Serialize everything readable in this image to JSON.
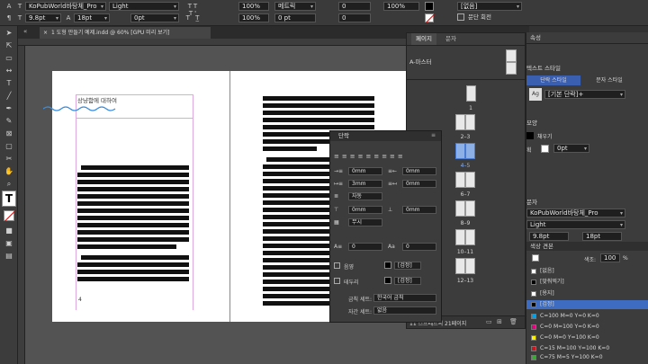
{
  "control_bar": {
    "font_family": "KoPubWorld바탕체_Pro",
    "font_style": "Light",
    "font_size": "9.8pt",
    "leading": "18pt",
    "kerning": "0",
    "tracking": "0pt",
    "scale_h": "100%",
    "scale_v": "100%",
    "baseline_kern": "메트릭",
    "pt_field": "0 pt",
    "zero_field": "0",
    "zero_field2": "0",
    "pct1": "100%",
    "lang": "[없음]",
    "swatch_label": "[없음]",
    "rotate_label": "문단 회전",
    "row2_pt": "0 pt",
    "row2_zero": "0"
  },
  "doc_tab": "1 도형 만들기 예제.indd @ 60% [GPU 미리 보기]",
  "document": {
    "left_heading": "상냥함에 대하여",
    "page_number_left": "4"
  },
  "pages_panel": {
    "tabs": [
      "페이지",
      "문자"
    ],
    "master_label": "A-마스터",
    "spreads": [
      {
        "label": "1"
      },
      {
        "label": "2–3"
      },
      {
        "label": "4–5"
      },
      {
        "label": "6–7"
      },
      {
        "label": "8–9"
      },
      {
        "label": "10–11"
      },
      {
        "label": "12–13"
      }
    ],
    "thumb_letter": "A",
    "footer": "11 스프레드의 21페이지"
  },
  "paragraph_panel": {
    "title": "단락",
    "indent_left": "0mm",
    "indent_right": "0mm",
    "first_indent": "3mm",
    "last_indent": "0mm",
    "auto_label": "자동",
    "space_before": "0mm",
    "space_after": "0mm",
    "none_label": "무시",
    "drop_lines": "0",
    "drop_chars": "0",
    "shading_label": "음영",
    "border_label": "테두리",
    "shading_swatch": "[검정]",
    "border_swatch": "[검정]",
    "kinsoku_label": "금칙 세트:",
    "kinsoku_value": "한국어 금칙",
    "mojikumi_label": "자간 세트:",
    "mojikumi_value": "없음"
  },
  "right_panel": {
    "tab": "속성",
    "char_style_header": "텍스트 스타일",
    "para_style_tab": "단락 스타일",
    "char_style_tab": "문자 스타일",
    "para_style_value": "[기본 단락]+",
    "section_label": "모양",
    "fill_label": "채우기",
    "stroke_label": "획",
    "stroke_value": "0pt",
    "type_section": "문자",
    "font_value": "KoPubWorld바탕체_Pro",
    "style_value": "Light",
    "size_value": "9.8pt",
    "leading_value": "18pt",
    "swatches_title": "색상 견본",
    "tint_label": "색조:",
    "tint_value": "100",
    "tint_unit": "%",
    "swatches": [
      {
        "name": "[없음]",
        "color": "#ffffff"
      },
      {
        "name": "[맞춰찍기]",
        "color": "#000000"
      },
      {
        "name": "[용지]",
        "color": "#ffffff"
      },
      {
        "name": "[검정]",
        "color": "#000000"
      },
      {
        "name": "C=100 M=0 Y=0 K=0",
        "color": "#00a0e9"
      },
      {
        "name": "C=0 M=100 Y=0 K=0",
        "color": "#e4007f"
      },
      {
        "name": "C=0 M=0 Y=100 K=0",
        "color": "#fff100"
      },
      {
        "name": "C=15 M=100 Y=100 K=0",
        "color": "#c8161e"
      },
      {
        "name": "C=75 M=5 Y=100 K=0",
        "color": "#3aa935"
      },
      {
        "name": "C=100 M=90 Y=10 K=0",
        "color": "#1d2088"
      }
    ]
  }
}
